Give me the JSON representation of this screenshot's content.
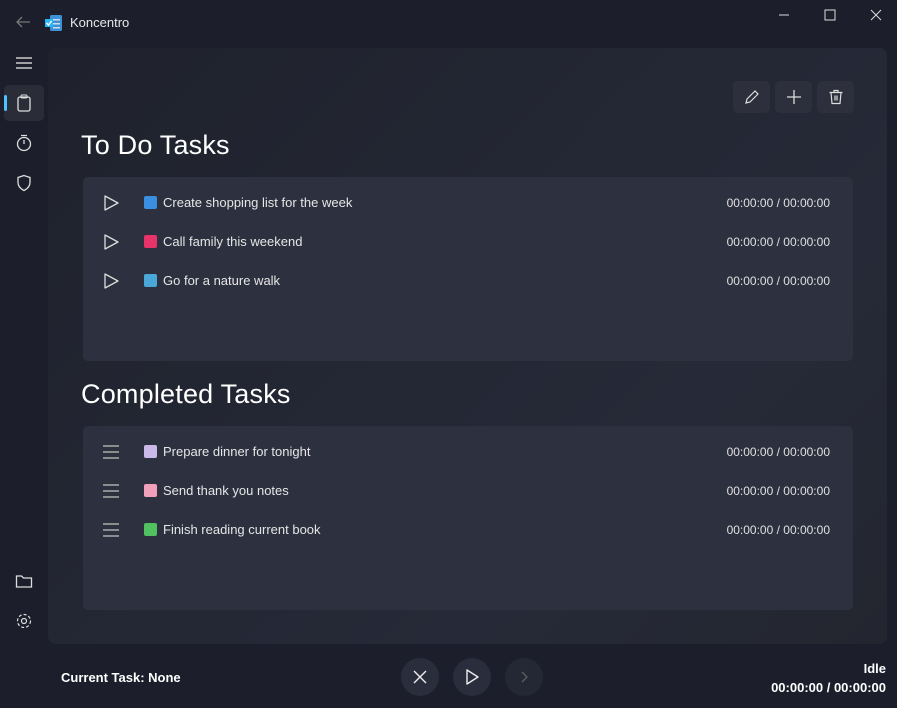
{
  "app": {
    "title": "Koncentro"
  },
  "toolbar": {
    "edit": "edit-icon",
    "add": "plus-icon",
    "delete": "trash-icon"
  },
  "todo": {
    "heading": "To Do Tasks",
    "tasks": [
      {
        "label": "Create shopping list for the week",
        "time": "00:00:00 / 00:00:00",
        "emoji_color": "#3b8fe0"
      },
      {
        "label": "Call family this weekend",
        "time": "00:00:00 / 00:00:00",
        "emoji_color": "#e8336a"
      },
      {
        "label": "Go for a nature walk",
        "time": "00:00:00 / 00:00:00",
        "emoji_color": "#4aa8d8"
      }
    ]
  },
  "completed": {
    "heading": "Completed Tasks",
    "tasks": [
      {
        "label": "Prepare dinner for tonight",
        "time": "00:00:00 / 00:00:00",
        "emoji_color": "#c9b8e8"
      },
      {
        "label": "Send thank you notes",
        "time": "00:00:00 / 00:00:00",
        "emoji_color": "#f0a0b8"
      },
      {
        "label": "Finish reading current book",
        "time": "00:00:00 / 00:00:00",
        "emoji_color": "#50c060"
      }
    ]
  },
  "footer": {
    "current_task": "Current Task: None",
    "status": "Idle",
    "time": "00:00:00 / 00:00:00"
  },
  "colors": {
    "accent": "#4cc2ff"
  }
}
